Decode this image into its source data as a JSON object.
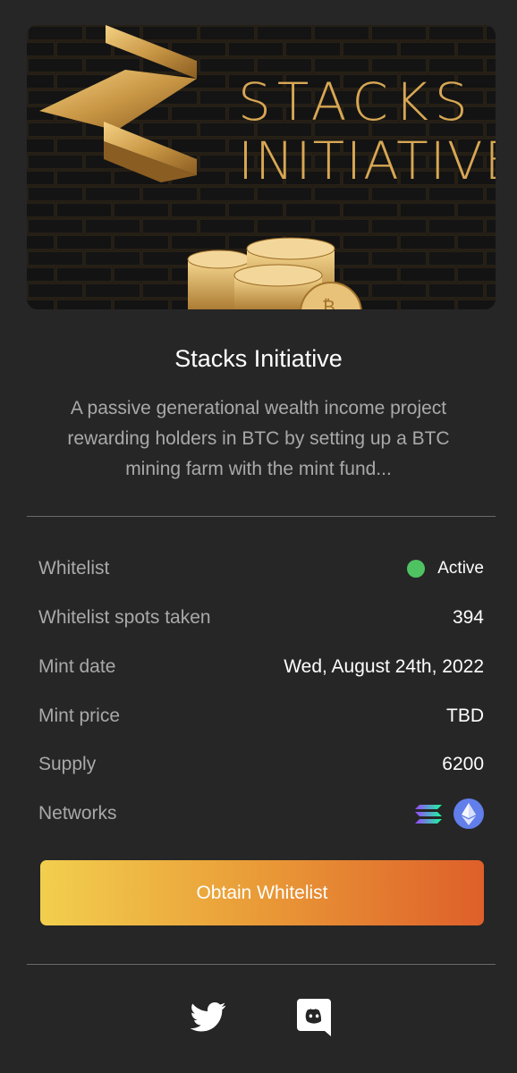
{
  "banner": {
    "title_line1": "STACKS",
    "title_line2": "INITIATIVE"
  },
  "project": {
    "title": "Stacks Initiative",
    "description": "A passive generational wealth income project rewarding holders in BTC by setting up a BTC mining farm with the mint fund..."
  },
  "details": {
    "whitelist_label": "Whitelist",
    "whitelist_status": "Active",
    "spots_label": "Whitelist spots taken",
    "spots_value": "394",
    "mint_date_label": "Mint date",
    "mint_date_value": "Wed, August 24th, 2022",
    "mint_price_label": "Mint price",
    "mint_price_value": "TBD",
    "supply_label": "Supply",
    "supply_value": "6200",
    "networks_label": "Networks",
    "networks": [
      "solana-icon",
      "ethereum-icon"
    ]
  },
  "cta": {
    "label": "Obtain Whitelist"
  },
  "social": [
    "twitter-icon",
    "discord-icon"
  ],
  "colors": {
    "background": "#262626",
    "status_active": "#4fc262",
    "gold": "#d8a754",
    "cta_gradient_start": "#f2cf4e",
    "cta_gradient_end": "#de5f2a",
    "ethereum_bg": "#627eea"
  }
}
